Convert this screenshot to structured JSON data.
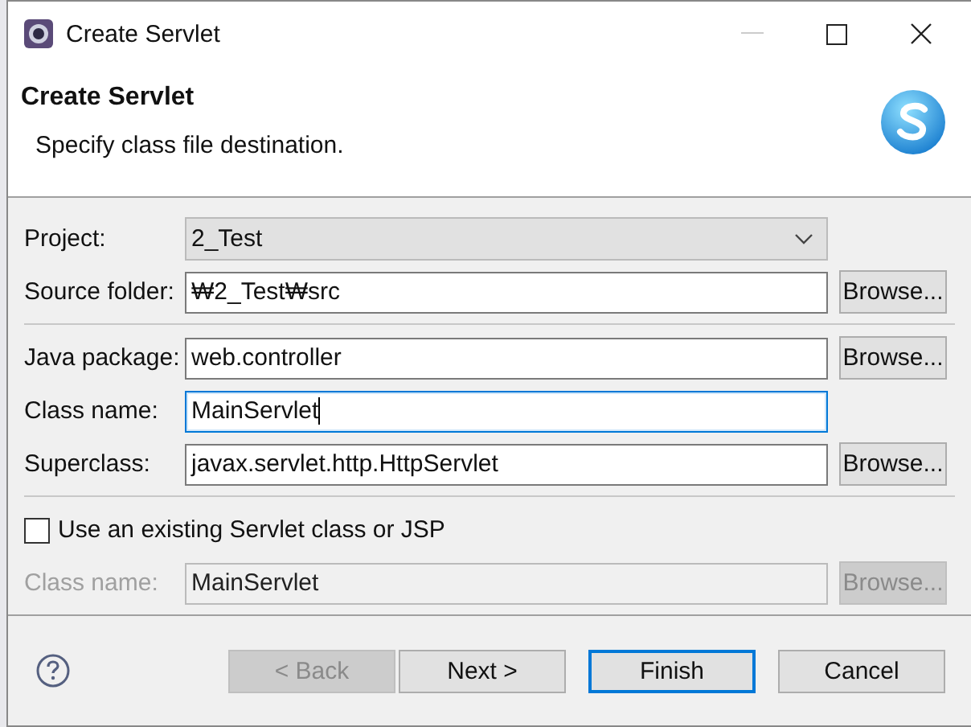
{
  "window": {
    "title": "Create Servlet"
  },
  "header": {
    "title": "Create Servlet",
    "message": "Specify class file destination."
  },
  "sections": [
    {
      "rows": [
        {
          "kind": "dropdown",
          "label": "Project:",
          "value": "2_Test"
        },
        {
          "kind": "text",
          "label": "Source folder:",
          "value": "₩2_Test₩src",
          "disabled": false,
          "focused": false,
          "browse": {
            "label": "Browse...",
            "disabled": false
          }
        }
      ]
    },
    {
      "rows": [
        {
          "kind": "text",
          "label": "Java package:",
          "value": "web.controller",
          "disabled": false,
          "focused": false,
          "browse": {
            "label": "Browse...",
            "disabled": false
          }
        },
        {
          "kind": "text",
          "label": "Class name:",
          "value": "MainServlet",
          "disabled": false,
          "focused": true
        },
        {
          "kind": "text",
          "label": "Superclass:",
          "value": "javax.servlet.http.HttpServlet",
          "disabled": false,
          "focused": false,
          "browse": {
            "label": "Browse...",
            "disabled": false
          }
        }
      ]
    },
    {
      "rows": [
        {
          "kind": "checkbox",
          "label": "Use an existing Servlet class or JSP",
          "checked": false
        },
        {
          "kind": "text",
          "label": "Class name:",
          "value": "MainServlet",
          "disabled": true,
          "focused": false,
          "browse": {
            "label": "Browse...",
            "disabled": true
          }
        }
      ]
    }
  ],
  "buttons": [
    {
      "label": "< Back",
      "disabled": true,
      "focused": false
    },
    {
      "label": "Next >",
      "disabled": false,
      "focused": false
    },
    {
      "label": "Finish",
      "disabled": false,
      "focused": true
    },
    {
      "label": "Cancel",
      "disabled": false,
      "focused": false
    }
  ]
}
